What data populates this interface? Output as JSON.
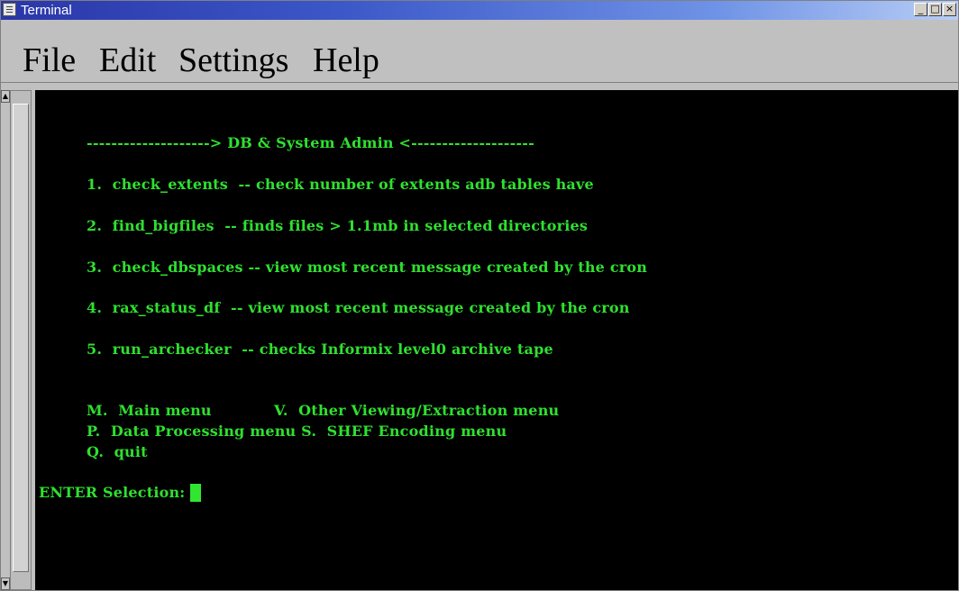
{
  "window": {
    "title": "Terminal",
    "buttons": {
      "minimize": "_",
      "maximize": "□",
      "close": "×"
    }
  },
  "menu": {
    "items": [
      {
        "label": "File"
      },
      {
        "label": "Edit"
      },
      {
        "label": "Settings"
      },
      {
        "label": "Help"
      }
    ]
  },
  "scrollbar": {
    "up_arrow": "▲",
    "down_arrow": "▼"
  },
  "terminal": {
    "header": "--------------------> DB & System Admin <--------------------",
    "options": [
      {
        "line": "1.  check_extents  -- check number of extents adb tables have"
      },
      {
        "line": "2.  find_bigfiles  -- finds files > 1.1mb in selected directories"
      },
      {
        "line": "3.  check_dbspaces -- view most recent message created by the cron"
      },
      {
        "line": "4.  rax_status_df  -- view most recent message created by the cron"
      },
      {
        "line": "5.  run_archecker  -- checks Informix level0 archive tape"
      }
    ],
    "nav": [
      {
        "line": "M.  Main menu            V.  Other Viewing/Extraction menu"
      },
      {
        "line": "P.  Data Processing menu S.  SHEF Encoding menu"
      },
      {
        "line": "Q.  quit"
      }
    ],
    "prompt": "ENTER Selection:",
    "colors": {
      "background": "#000000",
      "text": "#2fe02f"
    }
  }
}
